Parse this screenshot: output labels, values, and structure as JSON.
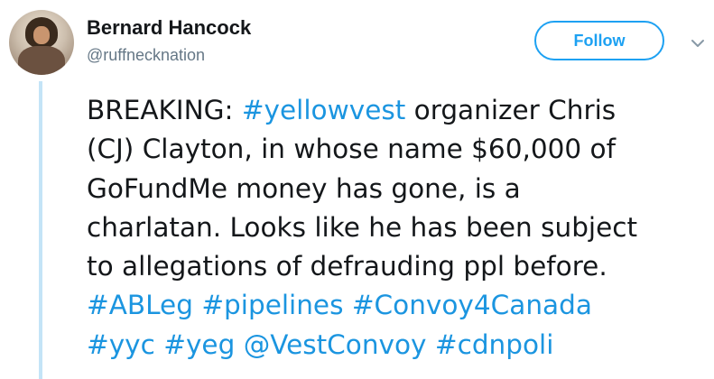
{
  "author": {
    "name": "Bernard Hancock",
    "handle": "@ruffnecknation"
  },
  "follow_label": "Follow",
  "icons": {
    "avatar": "user-avatar-photo",
    "menu": "chevron-down-icon"
  },
  "colors": {
    "link": "#1b95e0",
    "follow": "#1da1f2",
    "text": "#14171a",
    "secondary": "#657786",
    "thread_line": "#c4e4f7"
  },
  "tweet": {
    "lines": [
      [
        {
          "t": "BREAKING: ",
          "link": false
        },
        {
          "t": "#yellowvest",
          "link": true
        },
        {
          "t": " organizer Chris",
          "link": false
        }
      ],
      [
        {
          "t": "(CJ) Clayton, in whose name $60,000 of",
          "link": false
        }
      ],
      [
        {
          "t": "GoFundMe money has gone, is a",
          "link": false
        }
      ],
      [
        {
          "t": "charlatan. Looks like he has been subject",
          "link": false
        }
      ],
      [
        {
          "t": "to allegations of defrauding ppl before.",
          "link": false
        }
      ],
      [
        {
          "t": "#ABLeg",
          "link": true
        },
        {
          "t": " ",
          "link": false
        },
        {
          "t": "#pipelines",
          "link": true
        },
        {
          "t": " ",
          "link": false
        },
        {
          "t": "#Convoy4Canada",
          "link": true
        }
      ],
      [
        {
          "t": "#yyc",
          "link": true
        },
        {
          "t": " ",
          "link": false
        },
        {
          "t": "#yeg",
          "link": true
        },
        {
          "t": " ",
          "link": false
        },
        {
          "t": "@VestConvoy",
          "link": true
        },
        {
          "t": " ",
          "link": false
        },
        {
          "t": "#cdnpoli",
          "link": true
        }
      ]
    ]
  }
}
